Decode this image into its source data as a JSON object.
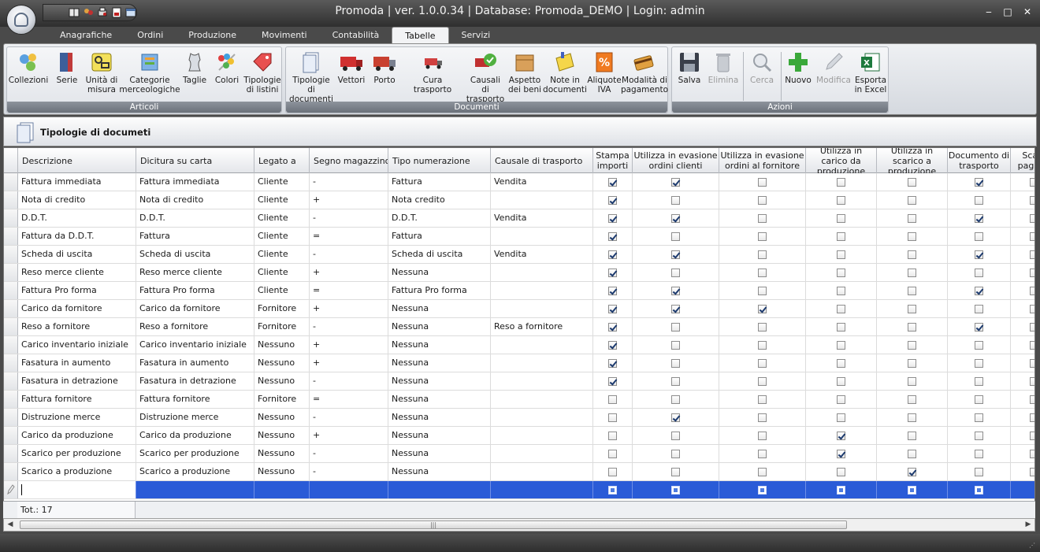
{
  "window": {
    "title": "Promoda | ver. 1.0.0.34 | Database: Promoda_DEMO | Login: admin",
    "minimize": "‒",
    "restore": "□",
    "close": "✕"
  },
  "tabs": [
    "Anagrafiche",
    "Ordini",
    "Produzione",
    "Movimenti",
    "Contabilità",
    "Tabelle",
    "Servizi"
  ],
  "active_tab": "Tabelle",
  "ribbon": {
    "groups": [
      {
        "label": "Articoli",
        "buttons": [
          {
            "label": "Collezioni",
            "icon": "collections-icon"
          },
          {
            "label": "Serie",
            "icon": "series-icon"
          },
          {
            "label": "Unità di\nmisura",
            "icon": "units-icon"
          },
          {
            "label": "Categorie\nmerceologiche",
            "icon": "categories-icon"
          },
          {
            "label": "Taglie",
            "icon": "sizes-icon"
          },
          {
            "label": "Colori",
            "icon": "colors-icon"
          },
          {
            "label": "Tipologie\ndi listini",
            "icon": "price-list-icon"
          }
        ]
      },
      {
        "label": "Documenti",
        "buttons": [
          {
            "label": "Tipologie di\ndocumenti",
            "icon": "document-types-icon"
          },
          {
            "label": "Vettori",
            "icon": "carrier-truck-icon"
          },
          {
            "label": "Porto",
            "icon": "port-truck-icon"
          },
          {
            "label": "Cura trasporto",
            "icon": "transport-care-icon"
          },
          {
            "label": "Causali di\ntrasporto",
            "icon": "transport-reason-icon"
          },
          {
            "label": "Aspetto\ndei beni",
            "icon": "goods-box-icon"
          },
          {
            "label": "Note in\ndocumenti",
            "icon": "notes-icon"
          },
          {
            "label": "Aliquote\nIVA",
            "icon": "vat-percent-icon"
          },
          {
            "label": "Modalità di\npagamento",
            "icon": "payment-card-icon"
          }
        ]
      },
      {
        "label": "Azioni",
        "buttons": [
          {
            "label": "Salva",
            "icon": "save-icon",
            "enabled": true
          },
          {
            "label": "Elimina",
            "icon": "trash-icon",
            "enabled": false
          },
          {
            "label": "Cerca",
            "icon": "search-icon",
            "enabled": false
          },
          {
            "label": "Nuovo",
            "icon": "add-icon",
            "enabled": true
          },
          {
            "label": "Modifica",
            "icon": "edit-icon",
            "enabled": false
          },
          {
            "label": "Esporta\nin Excel",
            "icon": "excel-icon",
            "enabled": true
          }
        ]
      }
    ]
  },
  "panel": {
    "title": "Tipologie di documeti"
  },
  "grid": {
    "columns": [
      "Descrizione",
      "Dicitura su carta",
      "Legato a",
      "Segno magazzino",
      "Tipo numerazione",
      "Causale di trasporto",
      "Stampa importi",
      "Utilizza in evasione ordini clienti",
      "Utilizza in evasione ordini al fornitore",
      "Utilizza in carico da produzione",
      "Utilizza in scarico a produzione",
      "Documento di trasporto",
      "Scad. pagam."
    ],
    "rows": [
      {
        "d": "Fattura immediata",
        "c": "Fattura immediata",
        "l": "Cliente",
        "s": "-",
        "n": "Fattura",
        "t": "Vendita",
        "f": [
          true,
          true,
          false,
          false,
          false,
          true,
          false
        ]
      },
      {
        "d": "Nota di credito",
        "c": "Nota di credito",
        "l": "Cliente",
        "s": "+",
        "n": "Nota credito",
        "t": "",
        "f": [
          true,
          false,
          false,
          false,
          false,
          false,
          false
        ]
      },
      {
        "d": "D.D.T.",
        "c": "D.D.T.",
        "l": "Cliente",
        "s": "-",
        "n": "D.D.T.",
        "t": "Vendita",
        "f": [
          true,
          true,
          false,
          false,
          false,
          true,
          false
        ]
      },
      {
        "d": "Fattura da D.D.T.",
        "c": "Fattura",
        "l": "Cliente",
        "s": "=",
        "n": "Fattura",
        "t": "",
        "f": [
          true,
          false,
          false,
          false,
          false,
          false,
          false
        ]
      },
      {
        "d": "Scheda di uscita",
        "c": "Scheda di uscita",
        "l": "Cliente",
        "s": "-",
        "n": "Scheda di uscita",
        "t": "Vendita",
        "f": [
          true,
          true,
          false,
          false,
          false,
          true,
          false
        ]
      },
      {
        "d": "Reso merce cliente",
        "c": "Reso merce cliente",
        "l": "Cliente",
        "s": "+",
        "n": "Nessuna",
        "t": "",
        "f": [
          true,
          false,
          false,
          false,
          false,
          false,
          false
        ]
      },
      {
        "d": "Fattura Pro forma",
        "c": "Fattura Pro forma",
        "l": "Cliente",
        "s": "=",
        "n": "Fattura Pro forma",
        "t": "",
        "f": [
          true,
          true,
          false,
          false,
          false,
          true,
          false
        ]
      },
      {
        "d": "Carico da fornitore",
        "c": "Carico da fornitore",
        "l": "Fornitore",
        "s": "+",
        "n": "Nessuna",
        "t": "",
        "f": [
          true,
          true,
          true,
          false,
          false,
          false,
          false
        ]
      },
      {
        "d": "Reso a fornitore",
        "c": "Reso a fornitore",
        "l": "Fornitore",
        "s": "-",
        "n": "Nessuna",
        "t": "Reso a fornitore",
        "f": [
          true,
          false,
          false,
          false,
          false,
          true,
          false
        ]
      },
      {
        "d": "Carico inventario iniziale",
        "c": "Carico inventario iniziale",
        "l": "Nessuno",
        "s": "+",
        "n": "Nessuna",
        "t": "",
        "f": [
          true,
          false,
          false,
          false,
          false,
          false,
          false
        ]
      },
      {
        "d": "Fasatura in aumento",
        "c": "Fasatura in aumento",
        "l": "Nessuno",
        "s": "+",
        "n": "Nessuna",
        "t": "",
        "f": [
          true,
          false,
          false,
          false,
          false,
          false,
          false
        ]
      },
      {
        "d": "Fasatura in detrazione",
        "c": "Fasatura in detrazione",
        "l": "Nessuno",
        "s": "-",
        "n": "Nessuna",
        "t": "",
        "f": [
          true,
          false,
          false,
          false,
          false,
          false,
          false
        ]
      },
      {
        "d": "Fattura fornitore",
        "c": "Fattura fornitore",
        "l": "Fornitore",
        "s": "=",
        "n": "Nessuna",
        "t": "",
        "f": [
          false,
          false,
          false,
          false,
          false,
          false,
          false
        ]
      },
      {
        "d": "Distruzione merce",
        "c": "Distruzione merce",
        "l": "Nessuno",
        "s": "-",
        "n": "Nessuna",
        "t": "",
        "f": [
          false,
          true,
          false,
          false,
          false,
          false,
          false
        ]
      },
      {
        "d": "Carico da produzione",
        "c": "Carico da produzione",
        "l": "Nessuno",
        "s": "+",
        "n": "Nessuna",
        "t": "",
        "f": [
          false,
          false,
          false,
          true,
          false,
          false,
          false
        ]
      },
      {
        "d": "Scarico per produzione",
        "c": "Scarico per produzione",
        "l": "Nessuno",
        "s": "-",
        "n": "Nessuna",
        "t": "",
        "f": [
          false,
          false,
          false,
          true,
          false,
          false,
          false
        ]
      },
      {
        "d": "Scarico a produzione",
        "c": "Scarico a produzione",
        "l": "Nessuno",
        "s": "-",
        "n": "Nessuna",
        "t": "",
        "f": [
          false,
          false,
          false,
          false,
          true,
          false,
          false
        ]
      }
    ],
    "total_label": "Tot.: 17"
  },
  "colors": {
    "selection": "#2a5bd7",
    "title_bar": "#3a3a3a",
    "ribbon_bg": "#e3e6ea"
  }
}
